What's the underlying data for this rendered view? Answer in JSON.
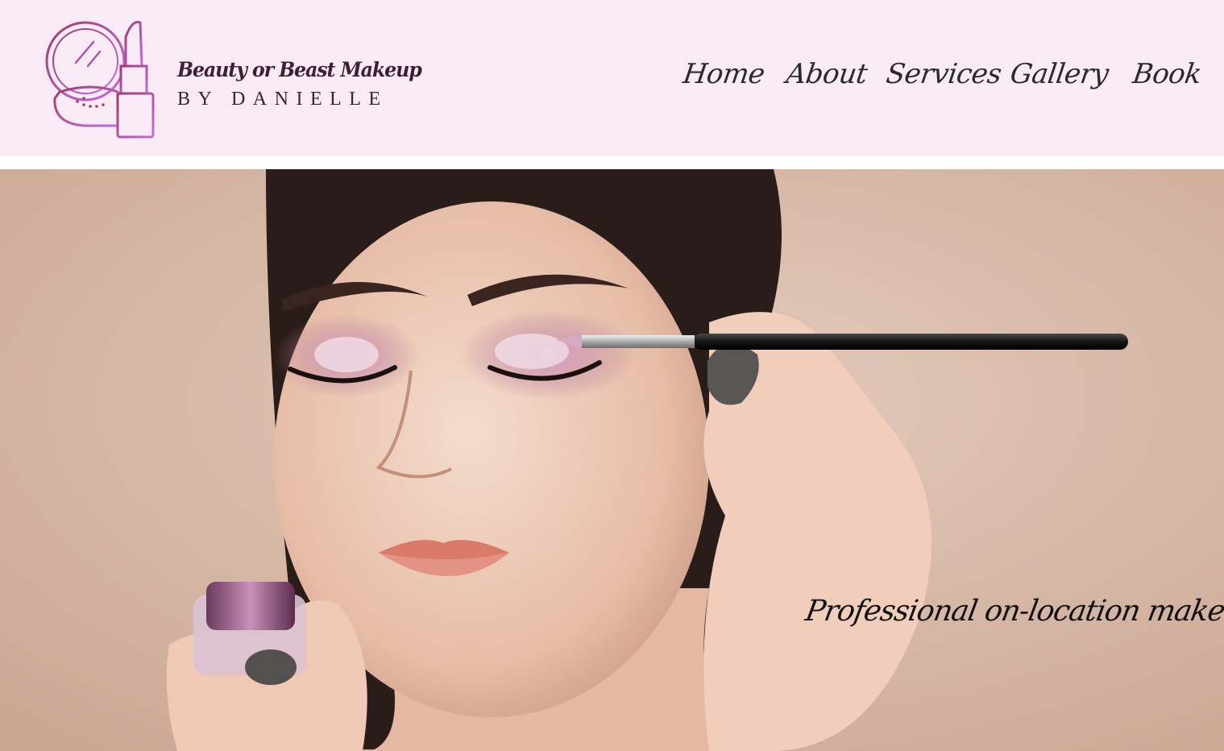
{
  "logo": {
    "title": "Beauty or Beast Makeup",
    "subtitle": "BY DANIELLE",
    "icon": "compact-and-lipstick-icon"
  },
  "nav": {
    "items": [
      {
        "label": "Home"
      },
      {
        "label": "About"
      },
      {
        "label": "Services"
      },
      {
        "label": "Gallery"
      },
      {
        "label": "Book"
      }
    ]
  },
  "hero": {
    "tagline": "Professional on-location makeup"
  },
  "colors": {
    "header_bg": "#f8ebf6",
    "logo_text": "#3e1f35",
    "logo_gradient_start": "#a23b6a",
    "logo_gradient_end": "#c06de0",
    "nav_text": "#2a2a2a",
    "hero_bg": "#d9b9a6"
  }
}
